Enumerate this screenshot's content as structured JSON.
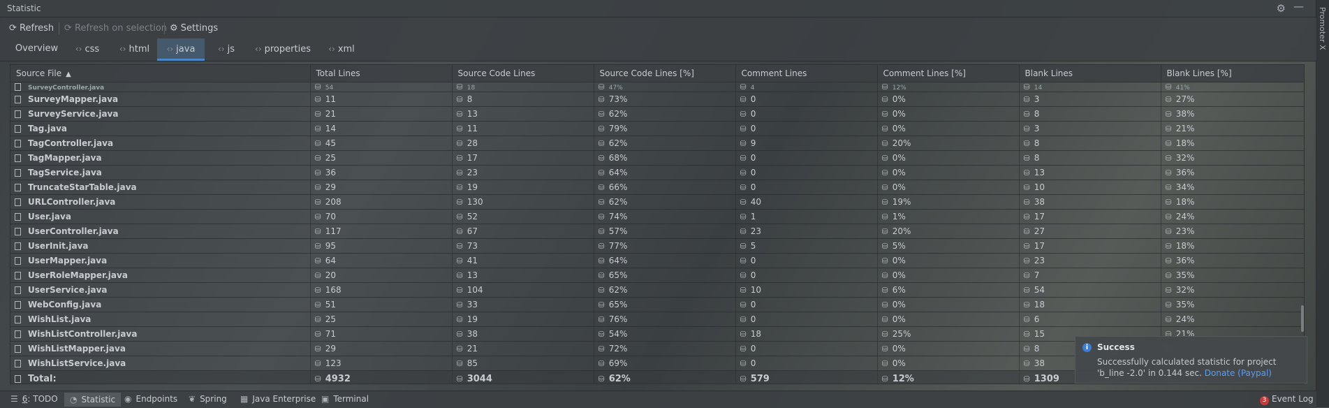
{
  "window": {
    "title": "Statistic",
    "right_strip_label": "Promoter X"
  },
  "toolbar": {
    "refresh": "Refresh",
    "refresh_selection": "Refresh on selection",
    "settings": "Settings"
  },
  "tabs": [
    {
      "label": "Overview",
      "icon": ""
    },
    {
      "label": "css",
      "icon": "<>"
    },
    {
      "label": "html",
      "icon": "<>"
    },
    {
      "label": "java",
      "icon": "<>",
      "active": true
    },
    {
      "label": "js",
      "icon": "<>"
    },
    {
      "label": "properties",
      "icon": "<>"
    },
    {
      "label": "xml",
      "icon": "<>"
    }
  ],
  "table": {
    "headers": [
      "Source File",
      "Total Lines",
      "Source Code Lines",
      "Source Code Lines [%]",
      "Comment Lines",
      "Comment Lines [%]",
      "Blank Lines",
      "Blank Lines [%]"
    ],
    "partial_row": [
      "SurveyController.java",
      "54",
      "18",
      "47%",
      "4",
      "12%",
      "14",
      "41%"
    ],
    "rows": [
      [
        "SurveyMapper.java",
        "11",
        "8",
        "73%",
        "0",
        "0%",
        "3",
        "27%"
      ],
      [
        "SurveyService.java",
        "21",
        "13",
        "62%",
        "0",
        "0%",
        "8",
        "38%"
      ],
      [
        "Tag.java",
        "14",
        "11",
        "79%",
        "0",
        "0%",
        "3",
        "21%"
      ],
      [
        "TagController.java",
        "45",
        "28",
        "62%",
        "9",
        "20%",
        "8",
        "18%"
      ],
      [
        "TagMapper.java",
        "25",
        "17",
        "68%",
        "0",
        "0%",
        "8",
        "32%"
      ],
      [
        "TagService.java",
        "36",
        "23",
        "64%",
        "0",
        "0%",
        "13",
        "36%"
      ],
      [
        "TruncateStarTable.java",
        "29",
        "19",
        "66%",
        "0",
        "0%",
        "10",
        "34%"
      ],
      [
        "URLController.java",
        "208",
        "130",
        "62%",
        "40",
        "19%",
        "38",
        "18%"
      ],
      [
        "User.java",
        "70",
        "52",
        "74%",
        "1",
        "1%",
        "17",
        "24%"
      ],
      [
        "UserController.java",
        "117",
        "67",
        "57%",
        "23",
        "20%",
        "27",
        "23%"
      ],
      [
        "UserInit.java",
        "95",
        "73",
        "77%",
        "5",
        "5%",
        "17",
        "18%"
      ],
      [
        "UserMapper.java",
        "64",
        "41",
        "64%",
        "0",
        "0%",
        "23",
        "36%"
      ],
      [
        "UserRoleMapper.java",
        "20",
        "13",
        "65%",
        "0",
        "0%",
        "7",
        "35%"
      ],
      [
        "UserService.java",
        "168",
        "104",
        "62%",
        "10",
        "6%",
        "54",
        "32%"
      ],
      [
        "WebConfig.java",
        "51",
        "33",
        "65%",
        "0",
        "0%",
        "18",
        "35%"
      ],
      [
        "WishList.java",
        "25",
        "19",
        "76%",
        "0",
        "0%",
        "6",
        "24%"
      ],
      [
        "WishListController.java",
        "71",
        "38",
        "54%",
        "18",
        "25%",
        "15",
        "21%"
      ],
      [
        "WishListMapper.java",
        "29",
        "21",
        "72%",
        "0",
        "0%",
        "8",
        ""
      ],
      [
        "WishListService.java",
        "123",
        "85",
        "69%",
        "0",
        "0%",
        "38",
        ""
      ]
    ],
    "total": [
      "Total:",
      "4932",
      "3044",
      "62%",
      "579",
      "12%",
      "1309",
      ""
    ]
  },
  "toast": {
    "title": "Success",
    "message": "Successfully calculated statistic for project 'b_line -2.0' in 0.144 sec.",
    "link": "Donate (Paypal)"
  },
  "statusbar": {
    "todo_num": "6",
    "todo": "TODO",
    "statistic": "Statistic",
    "endpoints": "Endpoints",
    "spring": "Spring",
    "java_enterprise": "Java Enterprise",
    "terminal": "Terminal",
    "event_count": "3",
    "event_log": "Event Log"
  }
}
